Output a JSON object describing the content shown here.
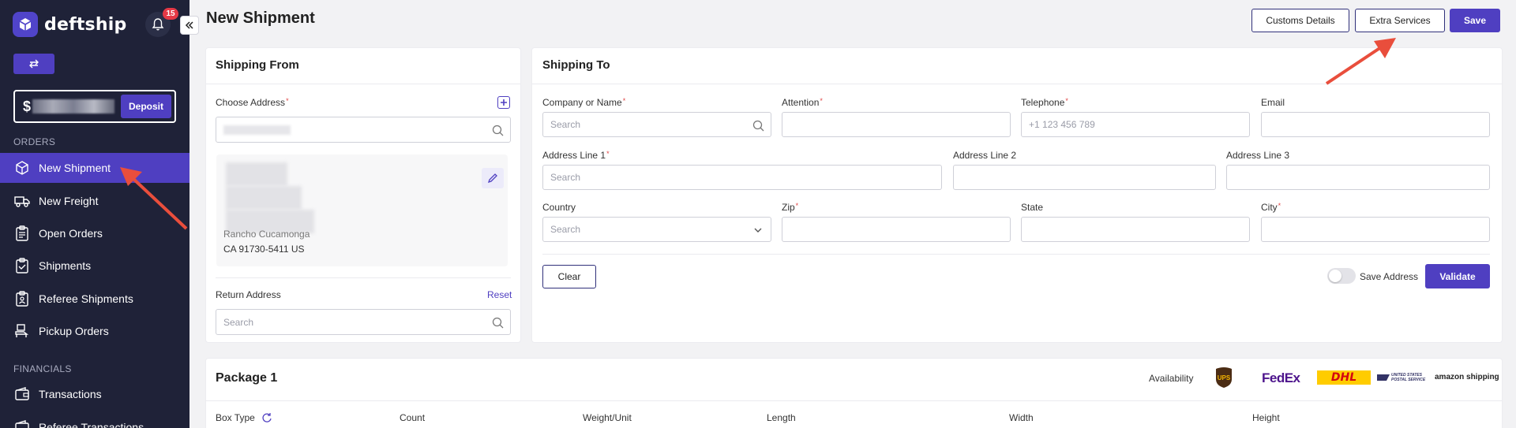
{
  "app": {
    "name": "deftship",
    "notification_count": "15"
  },
  "sidebar": {
    "balance_currency": "$",
    "deposit_label": "Deposit",
    "sections": {
      "orders": "ORDERS",
      "financials": "FINANCIALS"
    },
    "items": [
      {
        "label": "New Shipment",
        "icon": "box-icon",
        "active": true
      },
      {
        "label": "New Freight",
        "icon": "truck-icon"
      },
      {
        "label": "Open Orders",
        "icon": "clipboard-icon"
      },
      {
        "label": "Shipments",
        "icon": "clipboard-check-icon"
      },
      {
        "label": "Referee Shipments",
        "icon": "clipboard-user-icon"
      },
      {
        "label": "Pickup Orders",
        "icon": "pickup-icon"
      },
      {
        "label": "Transactions",
        "icon": "wallet-icon"
      },
      {
        "label": "Referee Transactions",
        "icon": "wallet-icon"
      }
    ]
  },
  "header": {
    "title": "New Shipment",
    "buttons": {
      "customs": "Customs Details",
      "extra": "Extra Services",
      "save": "Save"
    }
  },
  "shipping_from": {
    "title": "Shipping From",
    "choose_label": "Choose Address",
    "address_lines": [
      "Rancho Cucamonga",
      "CA 91730-5411 US"
    ],
    "return_label": "Return Address",
    "reset_label": "Reset",
    "return_placeholder": "Search"
  },
  "shipping_to": {
    "title": "Shipping To",
    "labels": {
      "company": "Company or Name",
      "attention": "Attention",
      "telephone": "Telephone",
      "email": "Email",
      "address1": "Address Line 1",
      "address2": "Address Line 2",
      "address3": "Address Line 3",
      "country": "Country",
      "zip": "Zip",
      "state": "State",
      "city": "City"
    },
    "placeholders": {
      "company": "Search",
      "telephone": "+1 123 456 789",
      "address1": "Search",
      "country": "Search"
    },
    "clear_label": "Clear",
    "save_address_label": "Save Address",
    "save_address_on": false,
    "validate_label": "Validate"
  },
  "package": {
    "title": "Package 1",
    "availability_label": "Availability",
    "carriers": [
      "UPS",
      "FedEx",
      "DHL",
      "UNITED STATES POSTAL SERVICE",
      "amazon shipping"
    ],
    "columns": [
      "Box Type",
      "Count",
      "Weight/Unit",
      "Length",
      "Width",
      "Height"
    ]
  },
  "colors": {
    "sidebar": "#1f2238",
    "accent": "#4f3fc1",
    "annotation": "#e94e3c"
  }
}
